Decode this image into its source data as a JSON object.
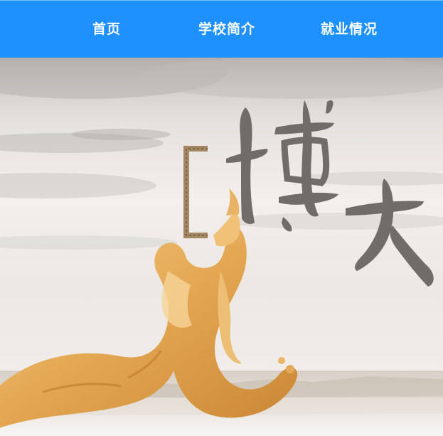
{
  "nav": {
    "items": [
      {
        "label": "首页"
      },
      {
        "label": "学校简介"
      },
      {
        "label": "就业情况"
      }
    ]
  },
  "banner": {
    "calligraphy": "博大",
    "colors": {
      "nav_bg": "#1e90ff",
      "ink": "#6f6c69",
      "dragon": "#e2a64e"
    }
  }
}
